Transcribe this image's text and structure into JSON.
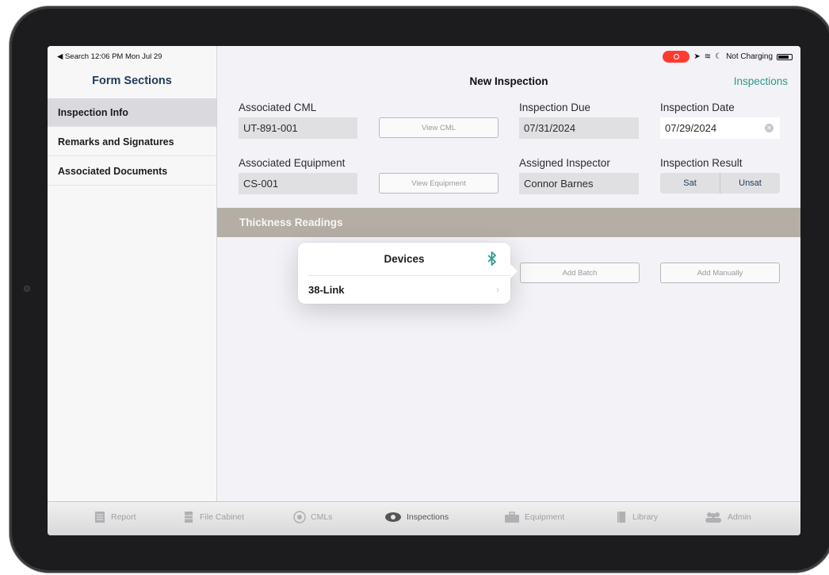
{
  "status": {
    "left": "◀ Search  12:06 PM  Mon Jul 29",
    "right": "Not Charging"
  },
  "sidebar": {
    "title": "Form Sections",
    "items": [
      {
        "label": "Inspection Info",
        "selected": true
      },
      {
        "label": "Remarks and Signatures",
        "selected": false
      },
      {
        "label": "Associated Documents",
        "selected": false
      }
    ]
  },
  "nav": {
    "title": "New Inspection",
    "right_link": "Inspections"
  },
  "form": {
    "cml_label": "Associated CML",
    "cml_value": "UT-891-001",
    "view_cml": "View CML",
    "due_label": "Inspection Due",
    "due_value": "07/31/2024",
    "date_label": "Inspection Date",
    "date_value": "07/29/2024",
    "equip_label": "Associated Equipment",
    "equip_value": "CS-001",
    "view_equip": "View Equipment",
    "inspector_label": "Assigned Inspector",
    "inspector_value": "Connor Barnes",
    "result_label": "Inspection Result",
    "result_options": [
      "Sat",
      "Unsat"
    ]
  },
  "thickness": {
    "title": "Thickness Readings",
    "add_batch": "Add Batch",
    "add_manually": "Add Manually"
  },
  "popover": {
    "title": "Devices",
    "device": "38-Link",
    "icon": "bluetooth-icon"
  },
  "tabbar": [
    {
      "label": "Report",
      "icon": "report-icon"
    },
    {
      "label": "File Cabinet",
      "icon": "file-cabinet-icon"
    },
    {
      "label": "CMLs",
      "icon": "target-icon"
    },
    {
      "label": "Inspections",
      "icon": "eye-icon",
      "active": true
    },
    {
      "label": "Equipment",
      "icon": "toolbox-icon"
    },
    {
      "label": "Library",
      "icon": "book-icon"
    },
    {
      "label": "Admin",
      "icon": "people-icon"
    }
  ],
  "colors": {
    "accent": "#2c9a8c",
    "section_bar": "#b5aea4",
    "recording": "#ff3b30"
  }
}
